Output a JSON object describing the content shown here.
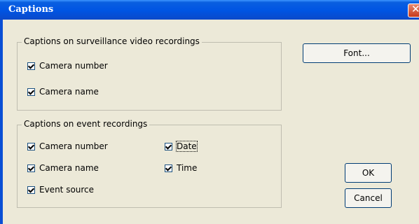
{
  "window": {
    "title": "Captions",
    "close_glyph": "✕"
  },
  "surveillance_group": {
    "label": "Captions on surveillance video recordings",
    "items": [
      {
        "label": "Camera number",
        "checked": true
      },
      {
        "label": "Camera name",
        "checked": true
      }
    ]
  },
  "event_group": {
    "label": "Captions on event recordings",
    "items": [
      {
        "label": "Camera number",
        "checked": true
      },
      {
        "label": "Camera name",
        "checked": true
      },
      {
        "label": "Event source",
        "checked": true
      },
      {
        "label": "Date",
        "checked": true
      },
      {
        "label": "Time",
        "checked": true
      }
    ]
  },
  "buttons": {
    "font": "Font...",
    "ok": "OK",
    "cancel": "Cancel"
  },
  "colors": {
    "titlebar": "#0054e3",
    "client_bg": "#ece9d8",
    "button_border": "#003c74"
  }
}
